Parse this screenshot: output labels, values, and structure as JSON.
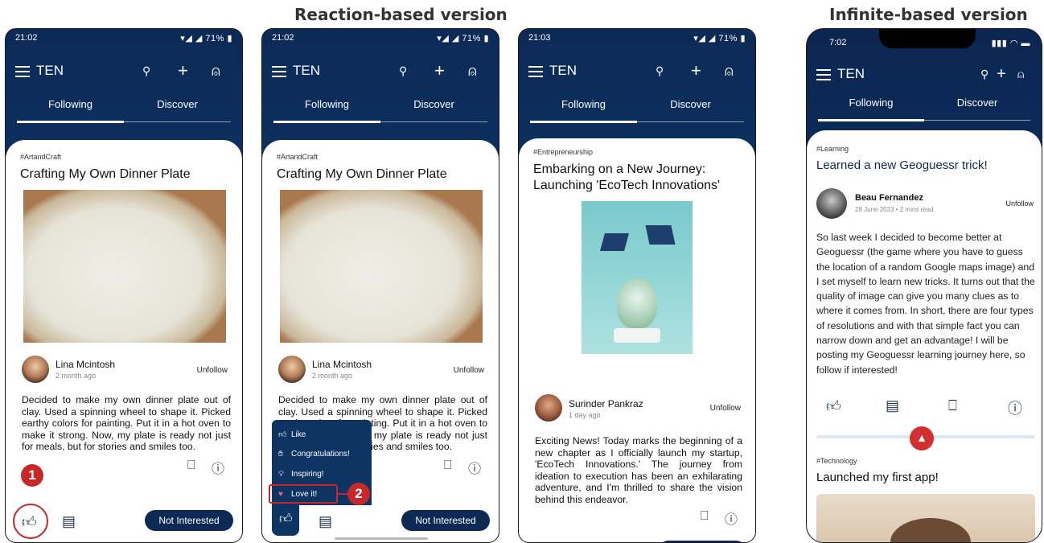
{
  "headings": {
    "reaction": "Reaction-based version",
    "infinite": "Infinite-based version"
  },
  "common": {
    "brand": "TEN",
    "tab_following": "Following",
    "tab_discover": "Discover",
    "not_interested": "Not Interested",
    "unfollow": "Unfollow"
  },
  "p1": {
    "time": "21:02",
    "battery": "71%",
    "tag": "#ArtandCraft",
    "title": "Crafting My Own Dinner Plate",
    "author": "Lina Mcintosh",
    "date": "2 month ago",
    "body": "Decided to make my own dinner plate out of clay. Used a spinning wheel to shape it. Picked earthy colors for painting. Put it in a hot oven to make it strong. Now, my plate is ready  not just for meals, but for stories and smiles too.",
    "marker": "1"
  },
  "p2": {
    "time": "21:02",
    "battery": "71%",
    "tag": "#ArtandCraft",
    "title": "Crafting My Own Dinner Plate",
    "author": "Lina Mcintosh",
    "date": "2 month ago",
    "body": "Decided to make my own dinner plate out of clay. Used a spinning wheel to shape it. Picked earthy colors for painting. Put it in a hot oven to make it strong. Now, my plate is ready  not just for meals, but for stories and smiles too.",
    "reactions": [
      "Like",
      "Congratulations!",
      "Inspiring!",
      "Love it!"
    ],
    "marker": "2"
  },
  "p3": {
    "time": "21:03",
    "battery": "71%",
    "tag": "#Entrepreneurship",
    "title": "Embarking on a New Journey: Launching 'EcoTech Innovations'",
    "author": "Surinder Pankraz",
    "date": "1 day ago",
    "body": "Exciting News! Today marks the beginning of a new chapter as I officially launch my startup, 'EcoTech Innovations.' The journey from ideation to execution has been an exhilarating adventure, and I'm thrilled to share the vision behind this endeavor."
  },
  "p4": {
    "time": "7:02",
    "tag": "#Learning",
    "title": "Learned a new Geoguessr trick!",
    "author": "Beau Fernandez",
    "date": "28 June 2023 • 2 mins read",
    "body": "So last week I decided to become better at Geoguessr (the game where you have to guess the location of a random Google maps image) and I set myself to learn new tricks. It turns out that the quality of image can give you many clues as to where it comes from. In short, there are four types of resolutions and with that simple fact you can narrow down and get an advantage! I will be posting my Geoguessr learning journey here, so follow if interested!",
    "tag2": "#Technology",
    "title2": "Launched my first app!"
  },
  "colors": {
    "navy": "#0d2a55",
    "accent": "#c62828"
  }
}
